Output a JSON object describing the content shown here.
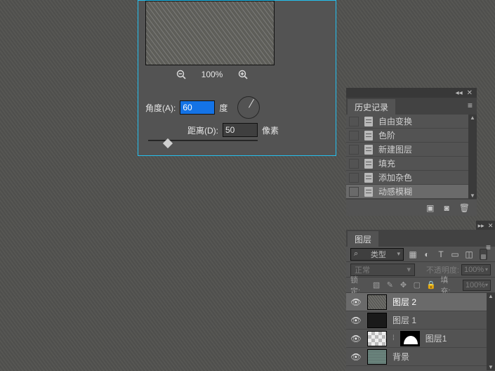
{
  "dialog": {
    "zoom": {
      "out": "−",
      "pct": "100%",
      "in": "+"
    },
    "angle_label": "角度(A):",
    "angle_value": "60",
    "angle_unit": "度",
    "distance_label": "距离(D):",
    "distance_value": "50",
    "distance_unit": "像素"
  },
  "history": {
    "title": "历史记录",
    "items": [
      "自由变换",
      "色阶",
      "新建图层",
      "填充",
      "添加杂色",
      "动感模糊"
    ],
    "active_index": 5,
    "footer": {
      "new_doc": "▣",
      "snapshot": "◙",
      "trash": "🗑"
    },
    "topbar": {
      "collapse": "◂◂",
      "close": "✕"
    },
    "menu": "≡"
  },
  "mini": {
    "collapse": "▸▸",
    "close": "✕"
  },
  "layers": {
    "title": "图层",
    "menu": "≡",
    "search_label": "类型",
    "filter_icons": {
      "image": "▦",
      "adjust": "◐",
      "type": "T",
      "shape": "▭",
      "smart": "◫"
    },
    "blend_mode": "正常",
    "opacity_label": "不透明度:",
    "opacity_value": "100%",
    "lock_label": "锁定:",
    "lock_icons": {
      "pixels": "▧",
      "brush": "✎",
      "position": "✥",
      "artboard": "▢",
      "all": "🔒"
    },
    "fill_label": "填充:",
    "fill_value": "100%",
    "rows": [
      {
        "name": "图层 2",
        "type": "texture",
        "mask": false,
        "active": true
      },
      {
        "name": "图层 1",
        "type": "black",
        "mask": false,
        "active": false
      },
      {
        "name": "图层1",
        "type": "checker",
        "mask": true,
        "active": false
      },
      {
        "name": "背景",
        "type": "bgimg",
        "mask": false,
        "active": false
      }
    ],
    "eye": "👁"
  }
}
